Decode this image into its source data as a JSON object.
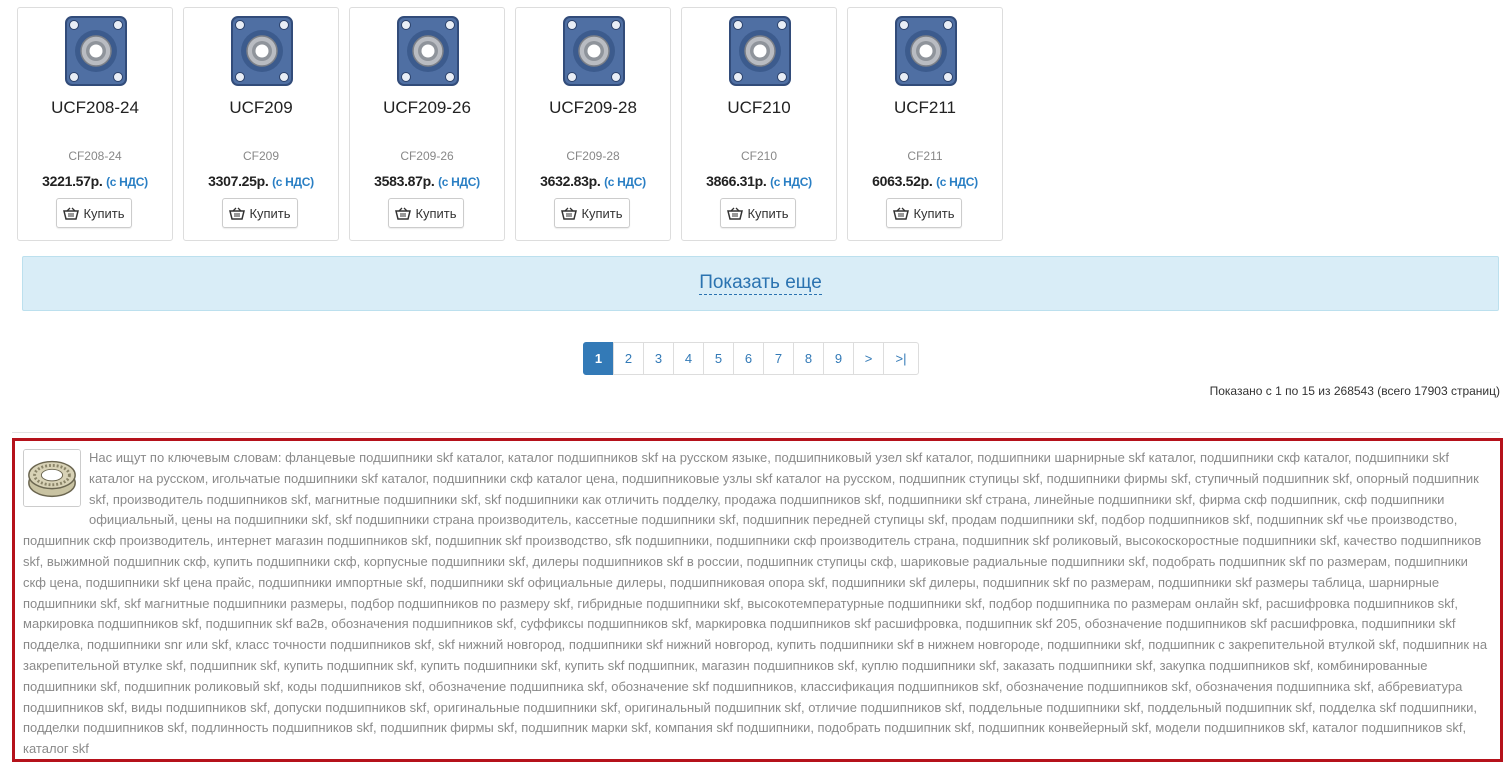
{
  "products": [
    {
      "name": "UCF208-24",
      "code": "CF208-24",
      "price": "3221.57р.",
      "vat": "(с НДС)",
      "buy": "Купить"
    },
    {
      "name": "UCF209",
      "code": "CF209",
      "price": "3307.25р.",
      "vat": "(с НДС)",
      "buy": "Купить"
    },
    {
      "name": "UCF209-26",
      "code": "CF209-26",
      "price": "3583.87р.",
      "vat": "(с НДС)",
      "buy": "Купить"
    },
    {
      "name": "UCF209-28",
      "code": "CF209-28",
      "price": "3632.83р.",
      "vat": "(с НДС)",
      "buy": "Купить"
    },
    {
      "name": "UCF210",
      "code": "CF210",
      "price": "3866.31р.",
      "vat": "(с НДС)",
      "buy": "Купить"
    },
    {
      "name": "UCF211",
      "code": "CF211",
      "price": "6063.52р.",
      "vat": "(с НДС)",
      "buy": "Купить"
    }
  ],
  "show_more": "Показать еще",
  "pagination": {
    "pages": [
      "1",
      "2",
      "3",
      "4",
      "5",
      "6",
      "7",
      "8",
      "9",
      ">",
      ">|"
    ],
    "current": "1"
  },
  "showing_text": "Показано с 1 по 15 из 268543 (всего 17903 страниц)",
  "keywords_text": "Нас ищут по ключевым словам: фланцевые подшипники skf каталог, каталог подшипников skf на русском языке, подшипниковый узел skf каталог, подшипники шарнирные skf каталог, подшипники скф каталог, подшипники skf каталог на русском, игольчатые подшипники skf каталог, подшипники скф каталог цена, подшипниковые узлы skf каталог на русском, подшипник ступицы skf, подшипники фирмы skf, ступичный подшипник skf, опорный подшипник skf, производитель подшипников skf, магнитные подшипники skf, skf подшипники как отличить подделку, продажа подшипников skf, подшипники skf страна, линейные подшипники skf, фирма скф подшипник, скф подшипники официальный, цены на подшипники skf, skf подшипники страна производитель, кассетные подшипники skf, подшипник передней ступицы skf, продам подшипники skf, подбор подшипников skf, подшипник skf чье производство, подшипник скф производитель, интернет магазин подшипников skf, подшипник skf производство, sfk подшипники, подшипники скф производитель страна, подшипник skf роликовый, высокоскоростные подшипники skf, качество подшипников skf, выжимной подшипник скф, купить подшипники скф, корпусные подшипники skf, дилеры подшипников skf в россии, подшипник ступицы скф, шариковые радиальные подшипники skf, подобрать подшипник skf по размерам, подшипники скф цена, подшипники skf цена прайс, подшипники импортные skf, подшипники skf официальные дилеры, подшипниковая опора skf, подшипники skf дилеры, подшипник skf по размерам, подшипники skf размеры таблица, шарнирные подшипники skf, skf магнитные подшипники размеры, подбор подшипников по размеру skf, гибридные подшипники skf, высокотемпературные подшипники skf, подбор подшипника по размерам онлайн skf, расшифровка подшипников skf, маркировка подшипников skf, подшипник skf ва2в, обозначения подшипников skf, суффиксы подшипников skf, маркировка подшипников skf расшифровка, подшипник skf 205, обозначение подшипников skf расшифровка, подшипники skf подделка, подшипники snr или skf, класс точности подшипников skf, skf нижний новгород, подшипники skf нижний новгород, купить подшипники skf в нижнем новгороде, подшипники skf, подшипник с закрепительной втулкой skf, подшипник на закрепительной втулке skf, подшипник skf, купить подшипник skf, купить подшипники skf, купить skf подшипник, магазин подшипников skf, куплю подшипники skf, заказать подшипники skf, закупка подшипников skf, комбинированные подшипники skf, подшипник роликовый skf, коды подшипников skf, обозначение подшипника skf, обозначение skf подшипников, классификация подшипников skf, обозначение подшипников skf, обозначения подшипника skf, аббревиатура подшипников skf, виды подшипников skf, допуски подшипников skf, оригинальные подшипники skf, оригинальный подшипник skf, отличие подшипников skf, поддельные подшипники skf, поддельный подшипник skf, подделка skf подшипники, подделки подшипников skf, подлинность подшипников skf, подшипник фирмы skf, подшипник марки skf, компания skf подшипники, подобрать подшипник skf, подшипник конвейерный skf, модели подшипников skf, каталог подшипников skf, каталог skf"
}
